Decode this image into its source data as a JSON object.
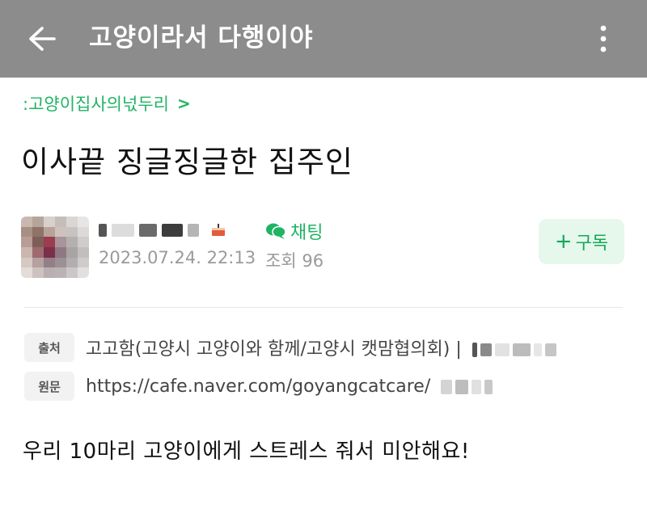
{
  "header": {
    "title": "고양이라서 다행이야",
    "back_icon": "arrow-left-icon",
    "more_icon": "more-vertical-icon",
    "background": "#8c8c8c"
  },
  "breadcrumb": {
    "label": ":고양이집사의넋두리",
    "chevron": ">"
  },
  "post": {
    "title": "이사끝 징글징글한 집주인",
    "date": "2023.07.24. 22:13",
    "views_label": "조회 96",
    "body": "우리 10마리 고양이에게 스트레스 줘서 미안해요!"
  },
  "author": {
    "chat_label": "채팅",
    "chat_icon": "chat-bubble-icon",
    "level_icon": "cake-level-icon"
  },
  "subscribe": {
    "label": "구독",
    "plus": "+"
  },
  "source": {
    "origin_tag": "출처",
    "origin_value": "고고함(고양시 고양이와 함께/고양시 캣맘협의회) |",
    "url_tag": "원문",
    "url_value": "https://cafe.naver.com/goyangcatcare/"
  },
  "colors": {
    "accent_green": "#1fb464",
    "subscribe_bg": "#e6f7ec",
    "meta_gray": "#9a9a9a"
  }
}
